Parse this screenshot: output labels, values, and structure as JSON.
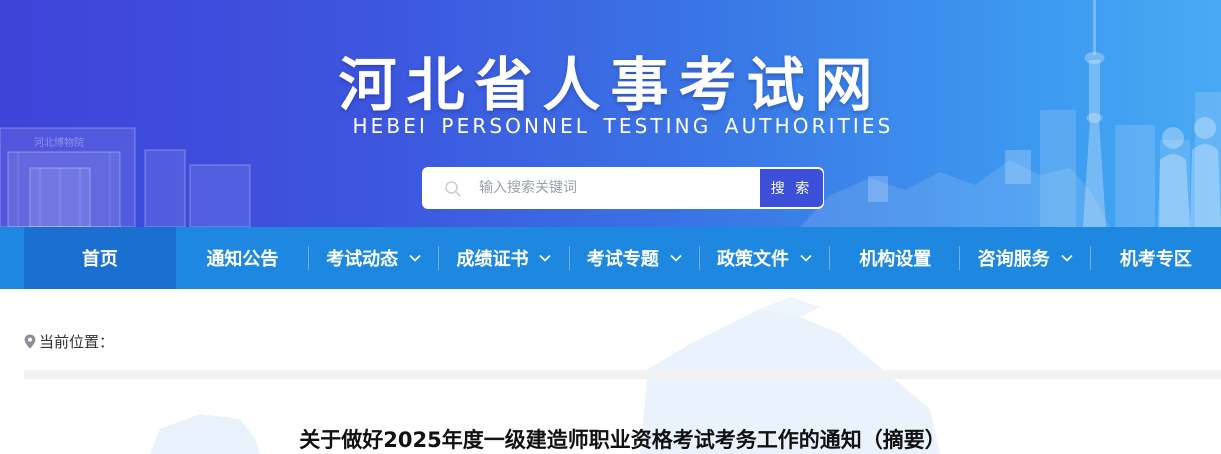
{
  "header": {
    "title": "河北省人事考试网",
    "subtitle": "HEBEI PERSONNEL TESTING AUTHORITIES",
    "building_sign": "河北博物院"
  },
  "search": {
    "placeholder": "输入搜索关键词",
    "value": "",
    "button_label": "搜 索"
  },
  "nav": {
    "items": [
      {
        "label": "首页",
        "dropdown": false,
        "active": true
      },
      {
        "label": "通知公告",
        "dropdown": false
      },
      {
        "label": "考试动态",
        "dropdown": true
      },
      {
        "label": "成绩证书",
        "dropdown": true
      },
      {
        "label": "考试专题",
        "dropdown": true
      },
      {
        "label": "政策文件",
        "dropdown": true
      },
      {
        "label": "机构设置",
        "dropdown": false
      },
      {
        "label": "咨询服务",
        "dropdown": true
      },
      {
        "label": "机考专区",
        "dropdown": false
      }
    ]
  },
  "breadcrumb": {
    "label": "当前位置："
  },
  "article": {
    "title": "关于做好2025年度一级建造师职业资格考试考务工作的通知（摘要）"
  },
  "colors": {
    "banner_left": "#3f43d9",
    "banner_right": "#4aa9f4",
    "nav_bg": "#1e88e0",
    "nav_active": "#1b6fd0",
    "search_button": "#3b4fd8"
  }
}
